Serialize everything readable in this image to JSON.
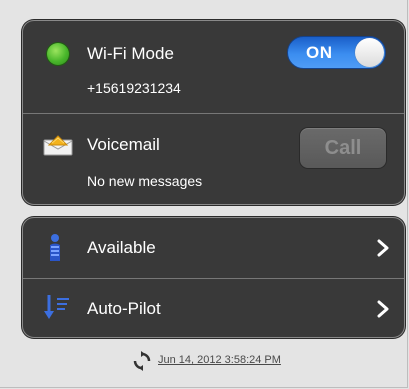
{
  "wifi": {
    "title": "Wi-Fi Mode",
    "phone_number": "+15619231234",
    "toggle_state": "ON",
    "status_color": "#49b72b"
  },
  "voicemail": {
    "title": "Voicemail",
    "status": "No new messages",
    "call_label": "Call"
  },
  "presence": {
    "label": "Available"
  },
  "autopilot": {
    "label": "Auto-Pilot"
  },
  "footer": {
    "last_updated": "Jun 14, 2012 3:58:24 PM"
  },
  "icons": {
    "status": "status-dot-icon",
    "voicemail": "envelope-icon",
    "presence": "person-icon",
    "autopilot": "sort-list-icon",
    "chevron": "chevron-right-icon",
    "refresh": "refresh-icon"
  },
  "colors": {
    "accent": "#3b8df0",
    "card_bg": "#393939",
    "page_bg": "#e4e4e4"
  }
}
